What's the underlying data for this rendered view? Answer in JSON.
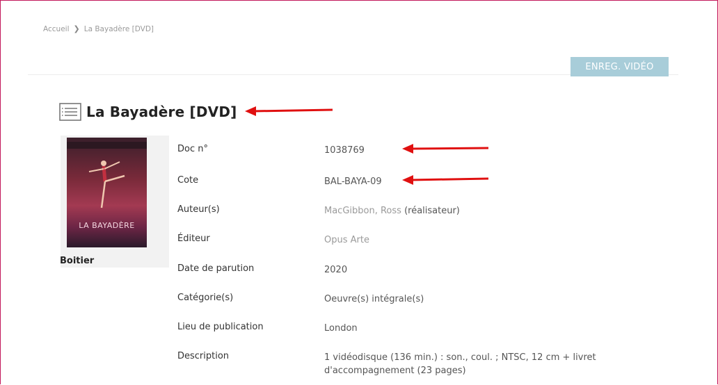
{
  "breadcrumb": {
    "home": "Accueil",
    "separator": "❯",
    "current": "La Bayadère [DVD]"
  },
  "badge": {
    "label": "ENREG. VIDÉO"
  },
  "record": {
    "title": "La Bayadère [DVD]",
    "cover": {
      "title": "LA BAYADÈRE",
      "caption": "Boitier"
    },
    "fields": [
      {
        "label": "Doc n°",
        "value": "1038769"
      },
      {
        "label": "Cote",
        "value": "BAL-BAYA-09"
      },
      {
        "label": "Auteur(s)",
        "value": "MacGibbon, Ross",
        "role": " (réalisateur)"
      },
      {
        "label": "Éditeur",
        "value": "Opus Arte"
      },
      {
        "label": "Date de parution",
        "value": "2020"
      },
      {
        "label": "Catégorie(s)",
        "value": "Oeuvre(s) intégrale(s)"
      },
      {
        "label": "Lieu de publication",
        "value": "London"
      },
      {
        "label": "Description",
        "value": "1 vidéodisque (136 min.) : son., coul. ; NTSC, 12 cm + livret d'accompagnement (23 pages)"
      }
    ]
  },
  "colors": {
    "frame_border": "#c2185b",
    "badge_bg": "#a8cdd9",
    "arrow": "#e01010"
  }
}
